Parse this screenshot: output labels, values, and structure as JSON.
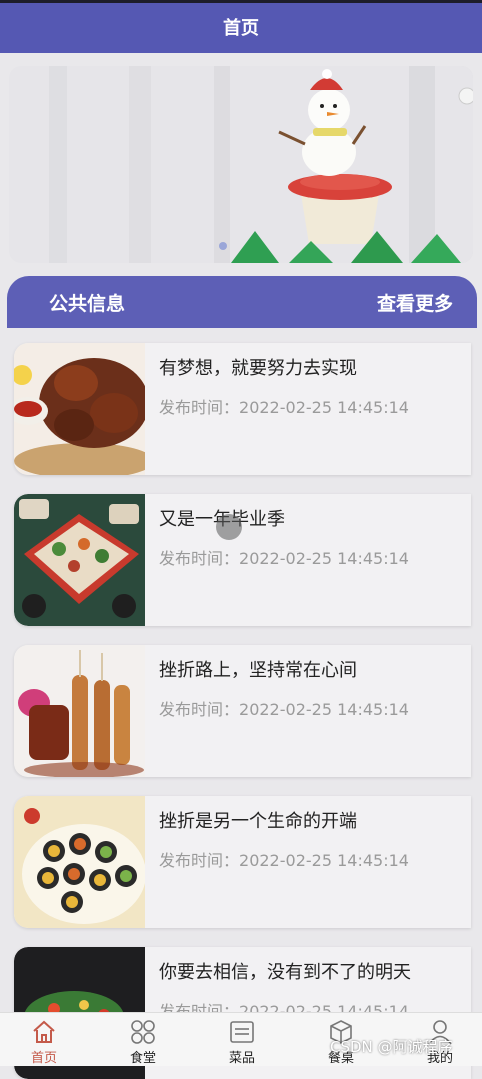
{
  "header": {
    "title": "首页"
  },
  "banner": {
    "indicator_count": 1,
    "active_index": 0
  },
  "section": {
    "title": "公共信息",
    "more_label": "查看更多"
  },
  "posts": [
    {
      "title": "有梦想，就要努力去实现",
      "time_label": "发布时间：",
      "time": "2022-02-25 14:45:14",
      "thumb": "grilled-meat-photo"
    },
    {
      "title": "又是一年毕业季",
      "time_label": "发布时间：",
      "time": "2022-02-25 14:45:14",
      "thumb": "platter-photo"
    },
    {
      "title": "挫折路上，坚持常在心间",
      "time_label": "发布时间：",
      "time": "2022-02-25 14:45:14",
      "thumb": "skewers-photo"
    },
    {
      "title": "挫折是另一个生命的开端",
      "time_label": "发布时间：",
      "time": "2022-02-25 14:45:14",
      "thumb": "sushi-photo"
    },
    {
      "title": "你要去相信，没有到不了的明天",
      "time_label": "发布时间：",
      "time": "2022-02-25 14:45:14",
      "thumb": "salad-photo"
    }
  ],
  "tabbar": {
    "items": [
      {
        "label": "首页",
        "icon": "home-icon",
        "active": true
      },
      {
        "label": "食堂",
        "icon": "grid-icon",
        "active": false
      },
      {
        "label": "菜品",
        "icon": "menu-icon",
        "active": false
      },
      {
        "label": "餐桌",
        "icon": "box-icon",
        "active": false
      },
      {
        "label": "我的",
        "icon": "user-icon",
        "active": false
      }
    ]
  },
  "watermark": "CSDN @阿诚程序",
  "colors": {
    "header": "#5558b3",
    "section": "#5d5fb6",
    "active_tab": "#c45a4a"
  }
}
